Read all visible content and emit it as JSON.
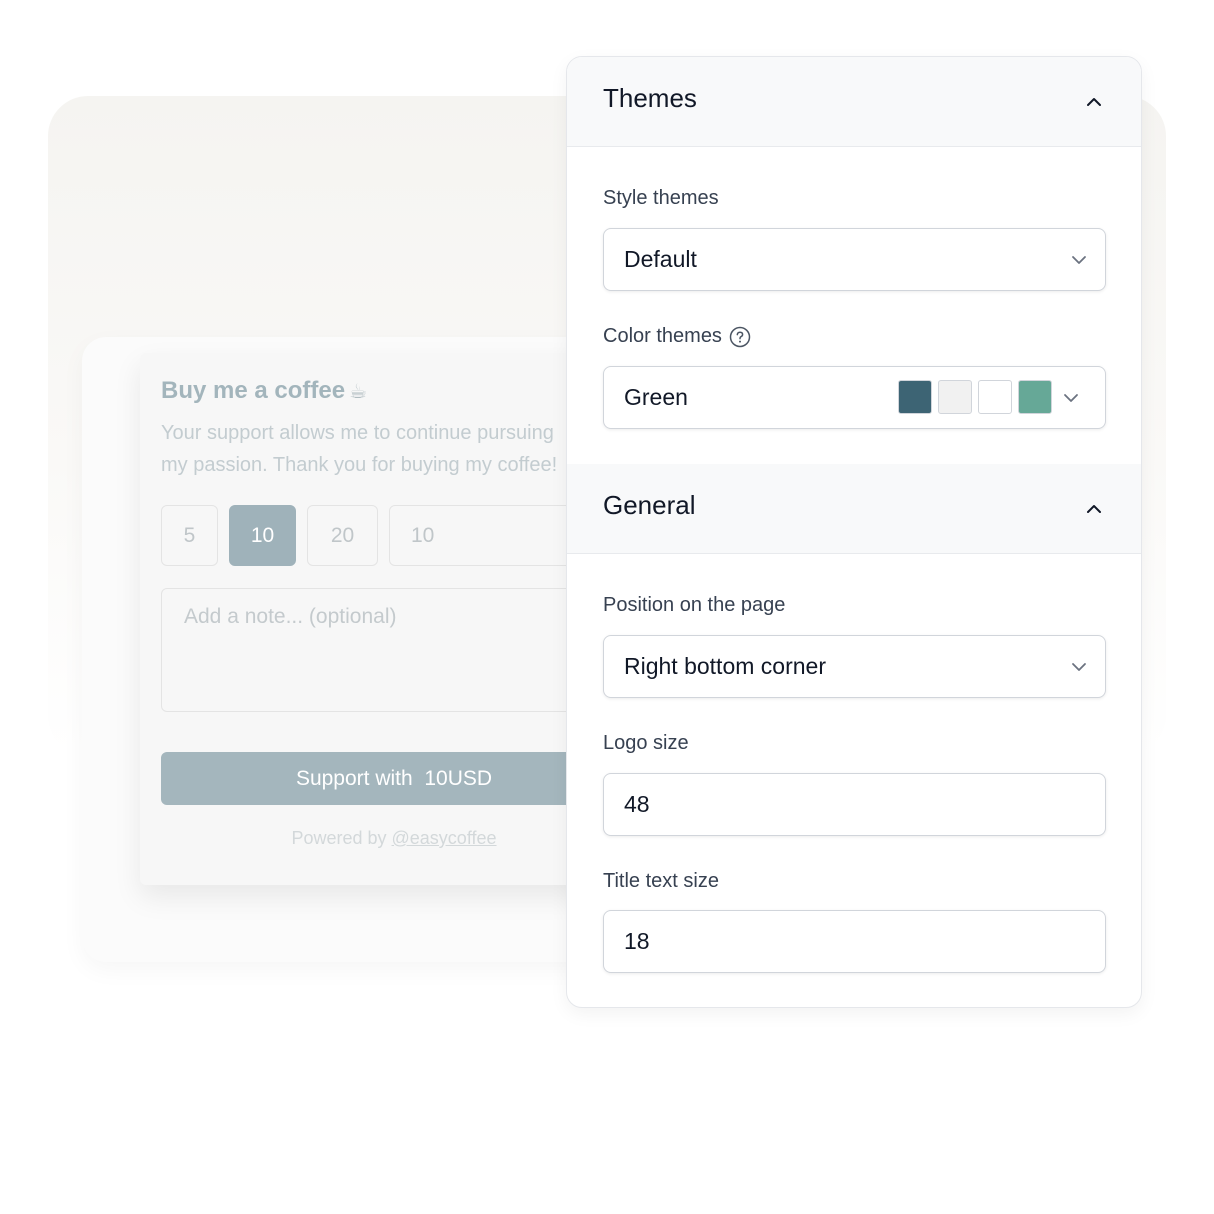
{
  "widget": {
    "title": "Buy me a coffee",
    "title_icon": "coffee-cup-icon",
    "description_line1": "Your support allows me to continue pursuing",
    "description_line2": "my passion. Thank you for buying my coffee!",
    "amounts": [
      "5",
      "10",
      "20"
    ],
    "selected_amount": "10",
    "custom_amount": "10",
    "note_placeholder": "Add a note... (optional)",
    "support_button": "Support with  10USD",
    "powered_prefix": "Powered by ",
    "powered_link": "@easycoffee",
    "accent_color": "#9fb2ba"
  },
  "panel": {
    "themes": {
      "title": "Themes",
      "style_label": "Style themes",
      "style_value": "Default",
      "color_label": "Color themes",
      "color_value": "Green",
      "swatches": [
        "#3d6474",
        "#f1f1f1",
        "#ffffff",
        "#66a897"
      ]
    },
    "general": {
      "title": "General",
      "position_label": "Position on the page",
      "position_value": "Right bottom corner",
      "logo_label": "Logo size",
      "logo_value": "48",
      "title_size_label": "Title text size",
      "title_size_value": "18"
    }
  }
}
